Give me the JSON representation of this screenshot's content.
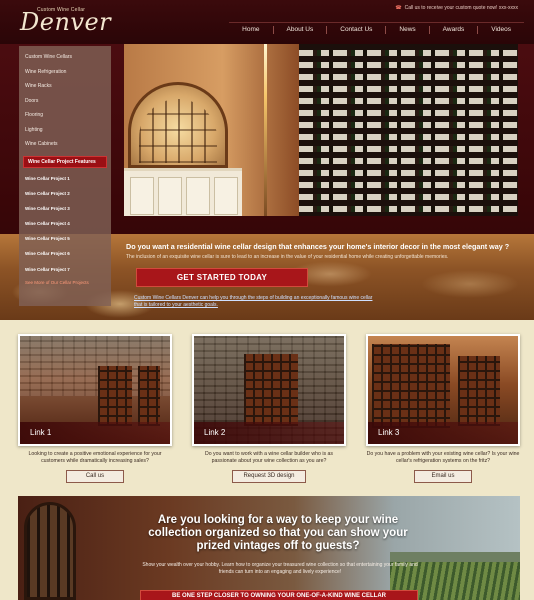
{
  "header": {
    "logo_small": "Custom Wine Cellar",
    "logo_big": "Denver",
    "call_text": "Call us to receive your custom quote now! xxx-xxxx",
    "nav": [
      "Home",
      "About Us",
      "Contact Us",
      "News",
      "Awards",
      "Videos"
    ]
  },
  "sidebar": {
    "items": [
      "Custom Wine Cellars",
      "Wine Refrigeration",
      "Wine Racks",
      "Doors",
      "Flooring",
      "Lighting",
      "Wine Cabinets"
    ],
    "featured_label": "Wine Cellar Project Features",
    "projects": [
      "Wine Cellar Project 1",
      "Wine Cellar Project 2",
      "Wine Cellar Project 3",
      "Wine Cellar Project 4",
      "Wine Cellar Project 5",
      "Wine Cellar Project 6",
      "Wine Cellar Project 7"
    ],
    "more_link": "See More of Our Cellar Projects"
  },
  "hero": {
    "question": "Do you want a residential wine cellar design that enhances your home's interior decor in the most elegant way ?",
    "paragraph": "The inclusion of an exquisite wine cellar is sure to lead to an increase in the value of your residential home while creating unforgettable memories.",
    "cta": "GET STARTED TODAY",
    "link": "Custom Wine Cellars Denver can help you through the steps of building an exceptionally famous wine cellar that is tailored to your aesthetic goals."
  },
  "cards": [
    {
      "label": "Link 1",
      "desc": "Looking to create a positive emotional experience for your customers while dramatically increasing sales?",
      "button": "Call us"
    },
    {
      "label": "Link 2",
      "desc": "Do you want to work with a wine cellar builder who is as passionate about your wine collection as you are?",
      "button": "Request 3D design"
    },
    {
      "label": "Link 3",
      "desc": "Do you have a problem with your existing wine cellar? Is your wine cellar's refrigeration systems on the fritz?",
      "button": "Email us"
    }
  ],
  "banner": {
    "headline": "Are you looking for a way to keep your wine collection organized so that you can show your prized vintages off to guests?",
    "paragraph": "Show your wealth over your hobby. Learn how to organize your treasured wine collection so that entertaining your family and friends can turn into an engaging and lively experience!",
    "cta": "BE ONE STEP CLOSER TO OWNING YOUR ONE-OF-A-KIND WINE CELLAR"
  },
  "colors": {
    "header_bg": "#3b0a0c",
    "accent": "#a8161a",
    "page_bg": "#efe7c9"
  }
}
